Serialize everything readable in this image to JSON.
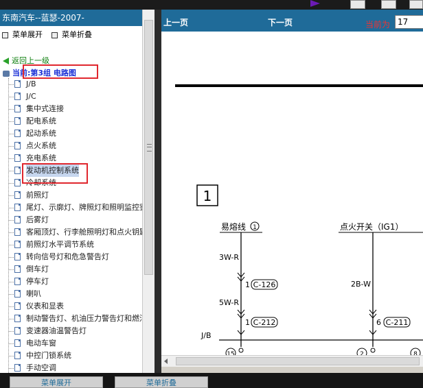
{
  "left_panel": {
    "title": "东南汽车--蓝瑟-2007-",
    "expand_label": "菜单展开",
    "collapse_label": "菜单折叠",
    "back_label": "返回上一级",
    "current_prefix": "当前",
    "current_label": ":第3组 电路图",
    "items": [
      "J/B",
      "J/C",
      "集中式连接",
      "配电系统",
      "起动系统",
      "点火系统",
      "充电系统",
      "发动机控制系统",
      "冷却系统",
      "前照灯",
      "尾灯、示廓灯、牌照灯和照明监控鉴",
      "后雾灯",
      "客厢顶灯、行李舱照明灯和点火钥匙",
      "前照灯水平调节系统",
      "转向信号灯和危急警告灯",
      "倒车灯",
      "停车灯",
      "喇叭",
      "仪表和显表",
      "制动警告灯、机油压力警告灯和燃油",
      "变速器油温警告灯",
      "电动车窗",
      "中控门锁系统",
      "手动空调"
    ],
    "selected_index": 7
  },
  "viewer": {
    "prev_label": "上一页",
    "next_label": "下一页",
    "current_label": "当前为",
    "page_value": "17"
  },
  "diagram": {
    "section": "1",
    "fuse_label": "易熔线",
    "fuse_num": "1",
    "ign_label": "点火开关（IG1）",
    "wire1": "3W-R",
    "conn1_pin": "1",
    "conn1": "C-126",
    "wire2": "5W-R",
    "conn2_pin": "1",
    "conn2": "C-212",
    "wire3": "2B-W",
    "conn3_pin": "6",
    "conn3": "C-211",
    "jb_label": "J/B",
    "bottom_nums": [
      "15",
      "2",
      "8"
    ]
  },
  "bottom_bar": {
    "btn1": "菜单展开",
    "btn2": "菜单折叠"
  },
  "colors": {
    "header_blue": "#1f6b99",
    "highlight_red": "#e0262d",
    "link_green": "#0d7f0d",
    "current_blue": "#1a2fd6"
  }
}
